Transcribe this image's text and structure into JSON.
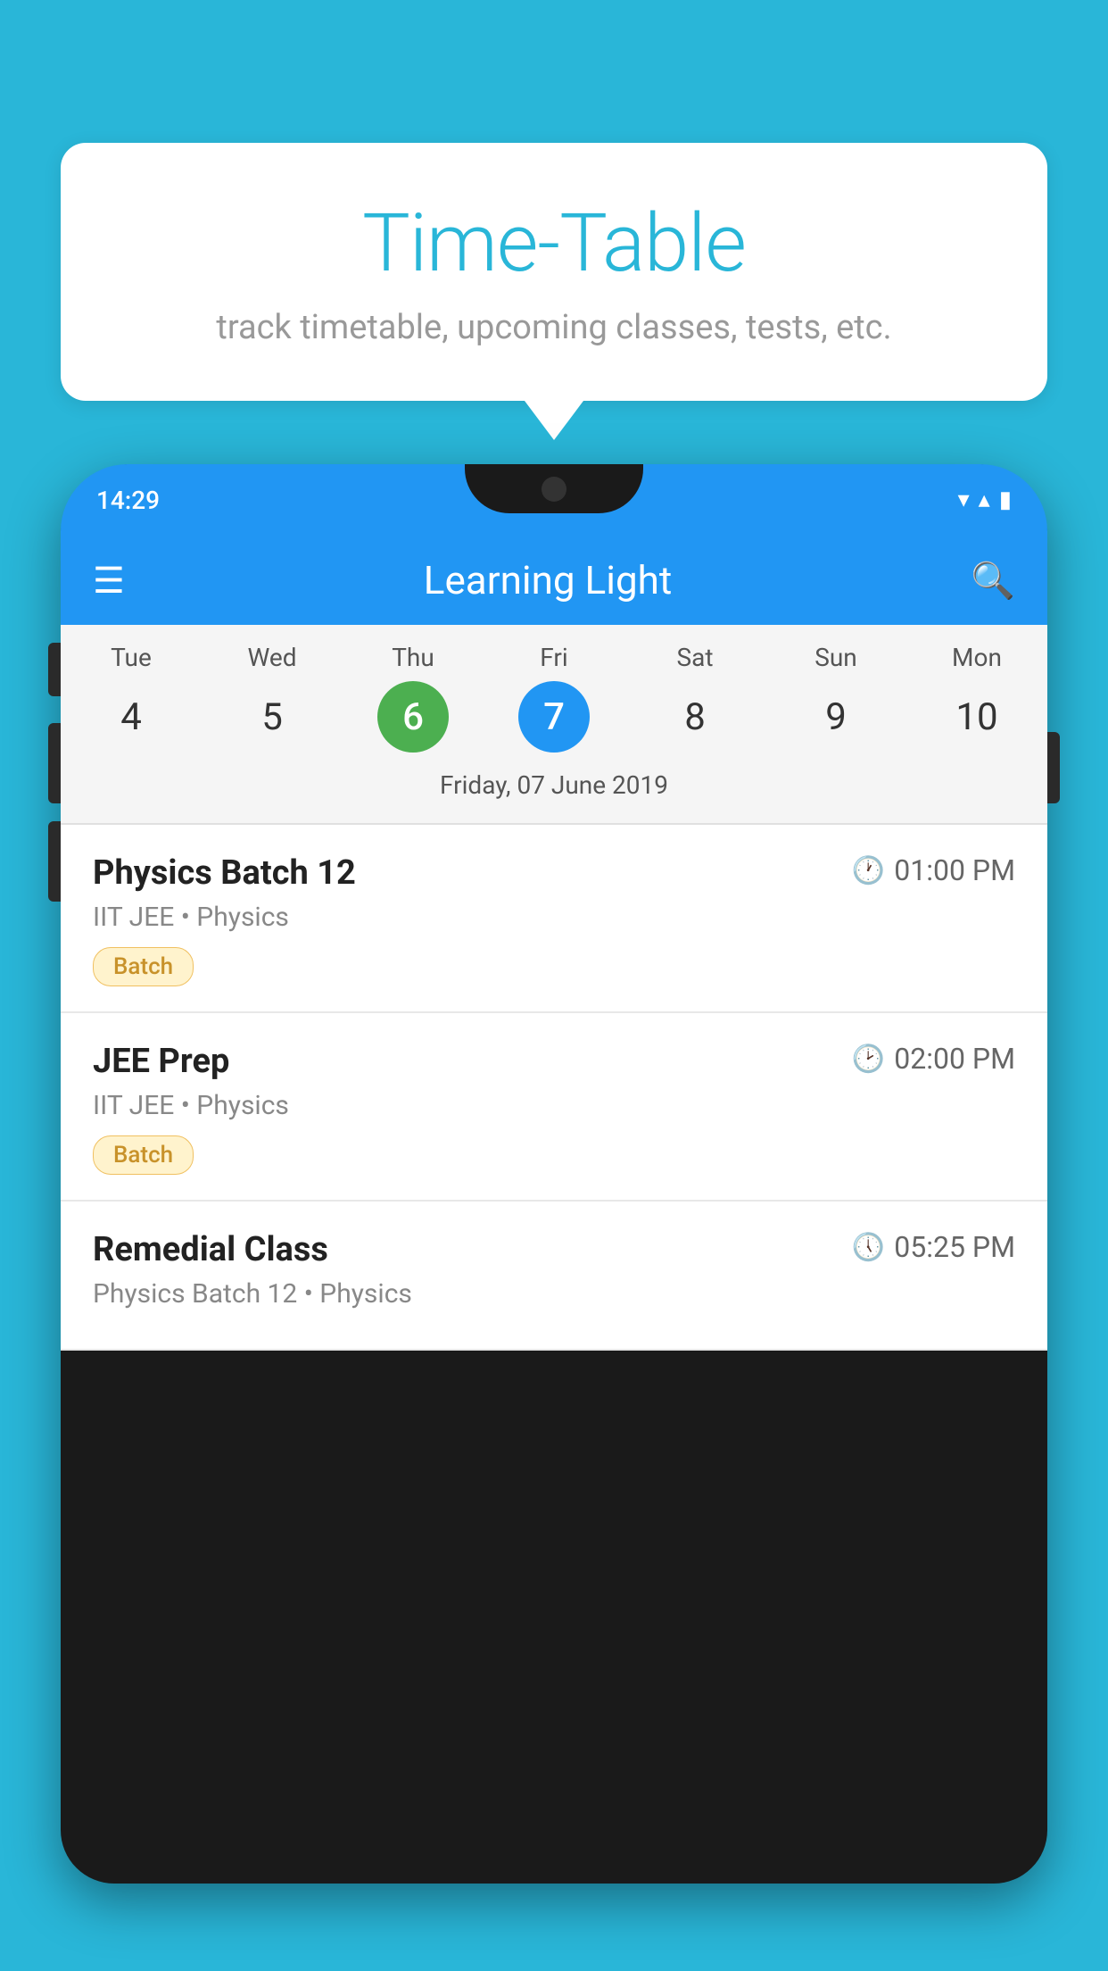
{
  "background_color": "#29b6d8",
  "speech_bubble": {
    "title": "Time-Table",
    "subtitle": "track timetable, upcoming classes, tests, etc."
  },
  "status_bar": {
    "time": "14:29",
    "wifi_icon": "▾",
    "signal_icon": "◂",
    "battery_icon": "▮"
  },
  "app_header": {
    "title": "Learning Light",
    "menu_icon": "☰",
    "search_icon": "🔍"
  },
  "calendar": {
    "days": [
      "Tue",
      "Wed",
      "Thu",
      "Fri",
      "Sat",
      "Sun",
      "Mon"
    ],
    "dates": [
      "4",
      "5",
      "6",
      "7",
      "8",
      "9",
      "10"
    ],
    "today_index": 2,
    "selected_index": 3,
    "selected_label": "Friday, 07 June 2019"
  },
  "schedule": [
    {
      "title": "Physics Batch 12",
      "time": "01:00 PM",
      "sub": "IIT JEE • Physics",
      "tag": "Batch"
    },
    {
      "title": "JEE Prep",
      "time": "02:00 PM",
      "sub": "IIT JEE • Physics",
      "tag": "Batch"
    },
    {
      "title": "Remedial Class",
      "time": "05:25 PM",
      "sub": "Physics Batch 12 • Physics",
      "tag": ""
    }
  ]
}
